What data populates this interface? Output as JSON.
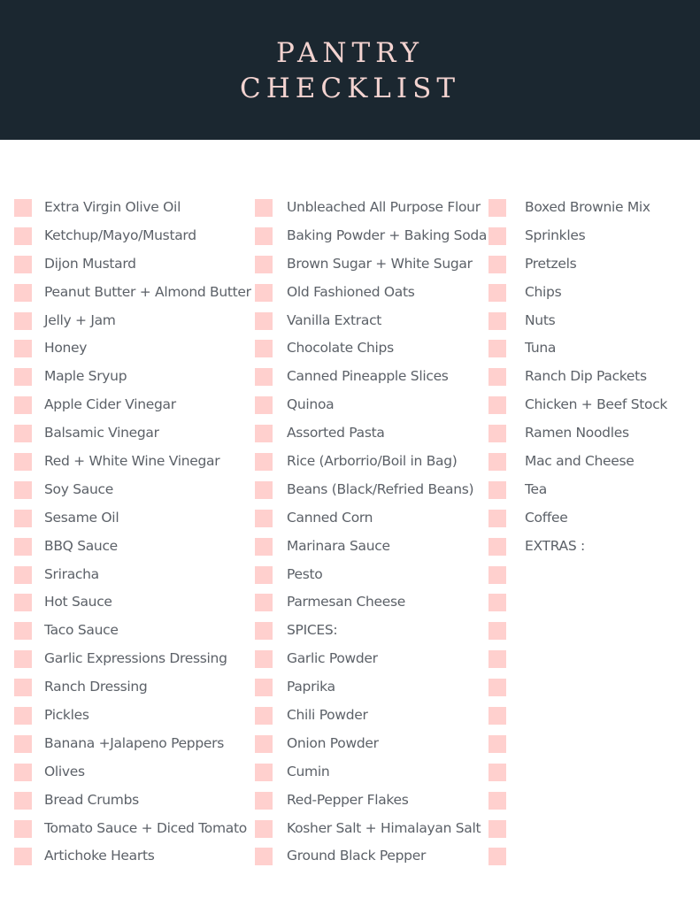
{
  "header": {
    "title_line1": "PANTRY",
    "title_line2": "CHECKLIST",
    "background_color": "#1b2730",
    "title_color": "#f3d3d0"
  },
  "checkbox_color": "#ffd0ce",
  "columns": [
    {
      "items": [
        "Extra Virgin Olive Oil",
        "Ketchup/Mayo/Mustard",
        "Dijon Mustard",
        "Peanut Butter + Almond Butter",
        "Jelly + Jam",
        "Honey",
        "Maple Sryup",
        "Apple Cider Vinegar",
        "Balsamic Vinegar",
        "Red + White Wine Vinegar",
        "Soy Sauce",
        "Sesame Oil",
        "BBQ Sauce",
        "Sriracha",
        "Hot Sauce",
        "Taco Sauce",
        "Garlic Expressions Dressing",
        "Ranch Dressing",
        "Pickles",
        "Banana +Jalapeno Peppers",
        "Olives",
        "Bread Crumbs",
        "Tomato Sauce + Diced Tomato",
        "Artichoke Hearts"
      ]
    },
    {
      "items": [
        "Unbleached All Purpose Flour",
        "Baking Powder + Baking Soda",
        "Brown Sugar + White Sugar",
        "Old Fashioned Oats",
        "Vanilla Extract",
        "Chocolate Chips",
        "Canned Pineapple Slices",
        "Quinoa",
        "Assorted Pasta",
        "Rice (Arborrio/Boil in Bag)",
        "Beans (Black/Refried Beans)",
        "Canned Corn",
        "Marinara Sauce",
        "Pesto",
        "Parmesan Cheese",
        "SPICES:",
        "Garlic Powder",
        "Paprika",
        "Chili Powder",
        "Onion Powder",
        "Cumin",
        "Red-Pepper Flakes",
        "Kosher Salt + Himalayan Salt",
        "Ground Black Pepper"
      ]
    },
    {
      "items": [
        "Boxed Brownie Mix",
        "Sprinkles",
        "Pretzels",
        "Chips",
        "Nuts",
        "Tuna",
        "Ranch Dip Packets",
        "Chicken + Beef Stock",
        "Ramen Noodles",
        "Mac and Cheese",
        "Tea",
        "Coffee",
        "EXTRAS :",
        "",
        "",
        "",
        "",
        "",
        "",
        "",
        "",
        "",
        "",
        ""
      ]
    }
  ]
}
